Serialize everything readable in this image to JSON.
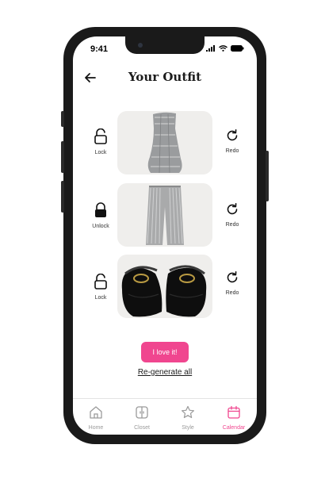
{
  "status_bar": {
    "time": "9:41"
  },
  "header": {
    "title": "Your Outfit"
  },
  "items": [
    {
      "lock_label": "Lock",
      "redo_label": "Redo",
      "locked": false,
      "image": "gray-strapless-dress"
    },
    {
      "lock_label": "Unlock",
      "redo_label": "Redo",
      "locked": true,
      "image": "striped-wide-leg-pants"
    },
    {
      "lock_label": "Lock",
      "redo_label": "Redo",
      "locked": false,
      "image": "black-chain-sandals"
    }
  ],
  "actions": {
    "love_label": "I love it!",
    "regenerate_label": "Re-generate all"
  },
  "tabbar": {
    "tabs": [
      {
        "label": "Home",
        "icon": "home-icon"
      },
      {
        "label": "Closet",
        "icon": "closet-icon"
      },
      {
        "label": "Style",
        "icon": "star-icon"
      },
      {
        "label": "Calendar",
        "icon": "calendar-icon"
      }
    ],
    "active": "Calendar"
  },
  "colors": {
    "accent": "#f0468f",
    "card_bg": "#efeeec",
    "frame": "#1a1a1a"
  }
}
